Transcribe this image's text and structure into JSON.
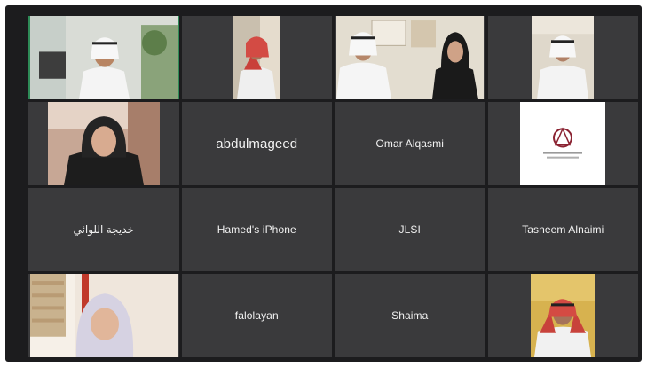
{
  "meeting": {
    "tiles": [
      {
        "type": "video",
        "scene": "man-white-ghutra-office"
      },
      {
        "type": "video",
        "scene": "man-red-ghutra-profile"
      },
      {
        "type": "video",
        "scene": "man-and-woman-office"
      },
      {
        "type": "video",
        "scene": "man-white-ghutra-wall"
      },
      {
        "type": "video",
        "scene": "woman-black-hijab"
      },
      {
        "type": "name",
        "name": "abdulmageed"
      },
      {
        "type": "name",
        "name": "Omar Alqasmi"
      },
      {
        "type": "logo",
        "scene": "organization-logo"
      },
      {
        "type": "name",
        "name": "خديجة اللوائي"
      },
      {
        "type": "name",
        "name": "Hamed's iPhone"
      },
      {
        "type": "name",
        "name": "JLSI"
      },
      {
        "type": "name",
        "name": "Tasneem Alnaimi"
      },
      {
        "type": "video",
        "scene": "woman-light-hijab"
      },
      {
        "type": "name",
        "name": "falolayan"
      },
      {
        "type": "name",
        "name": "Shaima"
      },
      {
        "type": "video",
        "scene": "man-red-ghutra-yellow-wall"
      }
    ]
  },
  "colors": {
    "frame": "#1c1c1e",
    "tile": "#3a3a3c",
    "name_text": "#f2f2f2",
    "active_outline": "#2e8b57"
  }
}
